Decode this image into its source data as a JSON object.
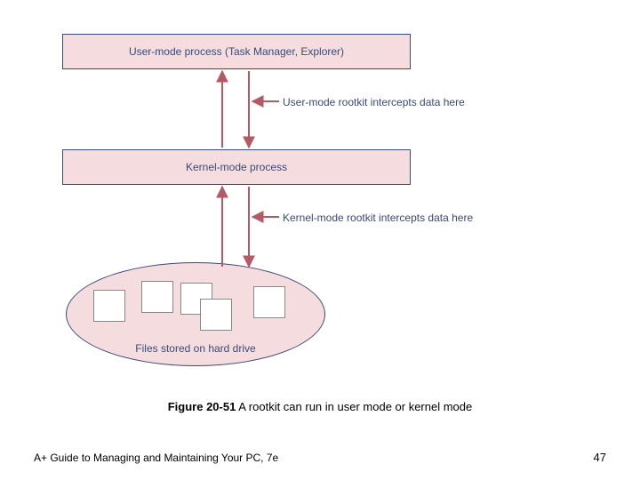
{
  "boxes": {
    "user_mode_process": "User-mode process (Task Manager, Explorer)",
    "kernel_mode_process": "Kernel-mode process"
  },
  "notes": {
    "user_intercept": "User-mode rootkit intercepts data here",
    "kernel_intercept": "Kernel-mode rootkit intercepts data here"
  },
  "ellipse_caption": "Files stored on hard drive",
  "figure_caption_strong": "Figure 20-51",
  "figure_caption_rest": " A rootkit can run in user mode or kernel mode",
  "footer_left": "A+ Guide to Managing and Maintaining Your PC, 7e",
  "footer_right": "47"
}
